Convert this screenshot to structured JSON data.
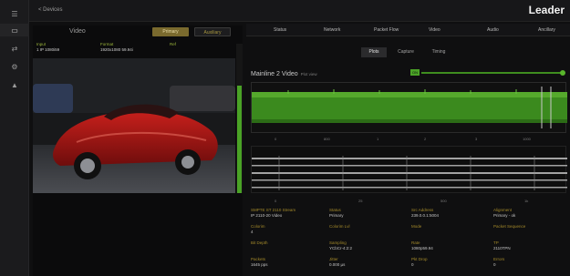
{
  "app": {
    "back_label": "< Devices",
    "brand": "Leader"
  },
  "rail": {
    "icons": [
      "menu-icon",
      "monitor-icon",
      "network-icon",
      "settings-icon",
      "warning-icon"
    ]
  },
  "video_panel": {
    "title": "Video",
    "buttons": {
      "primary": "Primary",
      "aux": "Auxiliary"
    },
    "meta": [
      {
        "label": "Input",
        "value": "1 IP 1080i59"
      },
      {
        "label": "Format",
        "value": "1920x1080 59.94i"
      },
      {
        "label": "Ref",
        "value": ""
      }
    ],
    "level_meter_fraction": 0.72
  },
  "right_nav": [
    "Status",
    "Network",
    "Packet Flow",
    "Video",
    "Audio",
    "Ancillary"
  ],
  "subtabs": [
    {
      "label": "Plots",
      "active": true
    },
    {
      "label": "Capture",
      "active": false
    },
    {
      "label": "Timing",
      "active": false
    }
  ],
  "waveform": {
    "title": "Mainline 2 Video",
    "subtitle": "Plot view",
    "badge": "ON",
    "slider_fraction": 1.0,
    "x_ticks": [
      "0",
      "800",
      "1",
      "2",
      "3",
      "1000"
    ]
  },
  "trace": {
    "x_ticks": [
      "0",
      "25",
      "500",
      "1k"
    ]
  },
  "stats": [
    {
      "label": "SMPTE ST 2110 Stream",
      "value": "IP 2110-20 Video"
    },
    {
      "label": "Status",
      "value": "Primary"
    },
    {
      "label": "Src Address",
      "value": "239.0.0.1:5004"
    },
    {
      "label": "Alignment",
      "value": "Primary - ok"
    },
    {
      "label": "Colorim",
      "value": "4"
    },
    {
      "label": "Colorim Lvl",
      "value": ""
    },
    {
      "label": "Mode",
      "value": ""
    },
    {
      "label": "Packet Sequence",
      "value": ""
    },
    {
      "label": "Bit Depth",
      "value": ""
    },
    {
      "label": "Sampling",
      "value": "YCbCr-4:2:2"
    },
    {
      "label": "Rate",
      "value": "1080p59.94"
    },
    {
      "label": "TP",
      "value": "2110TPN"
    },
    {
      "label": "Packets",
      "value": "1645 pps"
    },
    {
      "label": "Jitter",
      "value": "0.000 µs"
    },
    {
      "label": "Pkt Drop",
      "value": "0"
    },
    {
      "label": "Errors",
      "value": "0"
    }
  ],
  "colors": {
    "accent_gold": "#a48a2a",
    "accent_green": "#4aa326",
    "background": "#0f0f10"
  }
}
